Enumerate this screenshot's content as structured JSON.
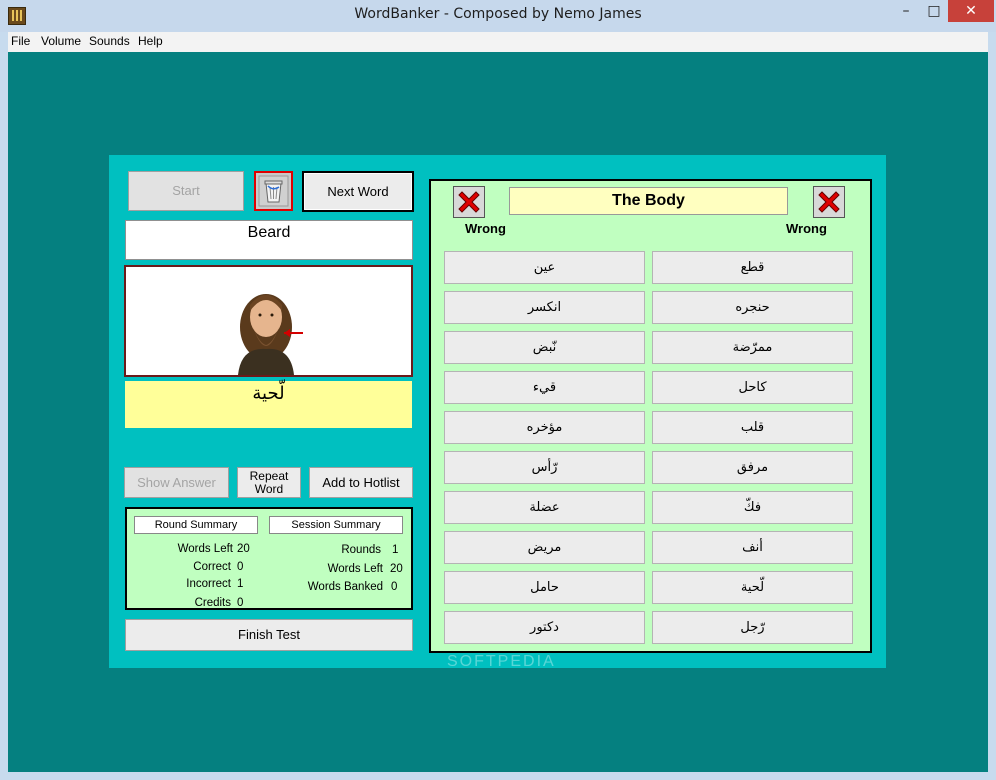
{
  "window": {
    "title": "WordBanker - Composed by Nemo James",
    "controls": {
      "minimize": "–",
      "maximize": "□",
      "close": "✕"
    }
  },
  "menu": [
    "File",
    "Volume",
    "Sounds",
    "Help"
  ],
  "left": {
    "start_label": "Start",
    "recycle_icon": "recycle-bin-icon",
    "next_word_label": "Next Word",
    "word": "Beard",
    "picture_icon": "bearded-man-portrait",
    "arabic_word": "لّحية",
    "show_answer_label": "Show Answer",
    "repeat_word_label_1": "Repeat",
    "repeat_word_label_2": "Word",
    "add_hotlist_label": "Add to  Hotlist",
    "finish_label": "Finish Test"
  },
  "summary": {
    "round_title": "Round Summary",
    "session_title": "Session Summary",
    "round": [
      {
        "label": "Words Left",
        "value": "20"
      },
      {
        "label": "Correct",
        "value": "0"
      },
      {
        "label": "Incorrect",
        "value": "1"
      },
      {
        "label": "Credits",
        "value": "0"
      }
    ],
    "session": [
      {
        "label": "Rounds",
        "value": "1"
      },
      {
        "label": "Words Left",
        "value": "20"
      },
      {
        "label": "Words Banked",
        "value": "0"
      }
    ]
  },
  "right": {
    "topic": "The Body",
    "wrong_left": "Wrong",
    "wrong_right": "Wrong",
    "answers_left": [
      "عين",
      "انكسر",
      "نّبض",
      "قيء",
      "مؤخره",
      "رّأس",
      "عضلة",
      "مريض",
      "حامل",
      "دكتور"
    ],
    "answers_right": [
      "قطع",
      "حنجره",
      "ممرّضة",
      "كاحل",
      "قلب",
      "مرفق",
      "فكّ",
      "أنف",
      "لّحية",
      "رّجل"
    ]
  },
  "watermark": "SOFTPEDIA",
  "colors": {
    "client_bg": "#058080",
    "panel_bg": "#00c0c0",
    "answer_panel_bg": "#c0ffc0",
    "word_highlight": "#ffff99",
    "wrong_x": "#e00000"
  }
}
